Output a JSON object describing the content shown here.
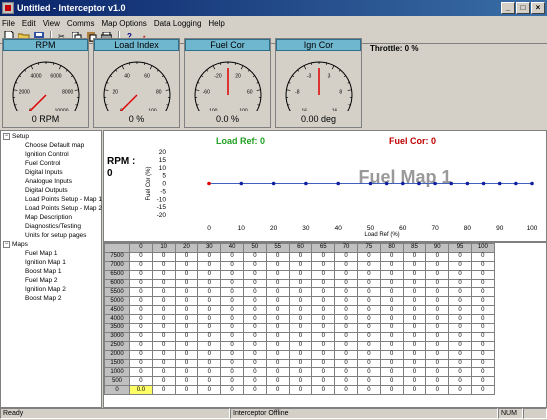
{
  "window": {
    "title": "Untitled - Interceptor v1.0"
  },
  "menu": [
    "File",
    "Edit",
    "View",
    "Comms",
    "Map Options",
    "Data Logging",
    "Help"
  ],
  "toolbar": [
    "new-icon",
    "open-icon",
    "save-icon",
    "cut-icon",
    "copy-icon",
    "paste-icon",
    "print-icon",
    "help-icon",
    "pin-icon"
  ],
  "gauges": [
    {
      "title": "RPM",
      "value_text": "0 RPM",
      "ticks": [
        "0",
        "2000",
        "4000",
        "6000",
        "8000",
        "10000"
      ],
      "min": 0,
      "max": 10000,
      "value": 0
    },
    {
      "title": "Load Index",
      "value_text": "0 %",
      "ticks": [
        "0",
        "20",
        "40",
        "60",
        "80",
        "100"
      ],
      "min": 0,
      "max": 100,
      "value": 0
    },
    {
      "title": "Fuel Cor",
      "value_text": "0.0 %",
      "ticks": [
        "-100",
        "-60",
        "-20",
        "20",
        "60",
        "100"
      ],
      "min": -100,
      "max": 100,
      "value": 0
    },
    {
      "title": "Ign Cor",
      "value_text": "0.00 deg",
      "ticks": [
        "-16",
        "-8",
        "-3",
        "3",
        "8",
        "16"
      ],
      "min": -16,
      "max": 16,
      "value": 0
    }
  ],
  "throttle": "Throttle: 0 %",
  "tree": {
    "setup_label": "Setup",
    "setup_items": [
      "Choose Default map",
      "Ignition Control",
      "Fuel Control",
      "Digital Inputs",
      "Analogue Inputs",
      "Digital Outputs",
      "Load Points Setup - Map 1",
      "Load Points Setup - Map 2",
      "Map Description",
      "Diagnostics/Testing",
      "Units for setup pages"
    ],
    "maps_label": "Maps",
    "maps_items": [
      "Fuel Map 1",
      "Ignition Map 1",
      "Boost Map 1",
      "Fuel Map 2",
      "Ignition Map 2",
      "Boost Map 2"
    ]
  },
  "panel": {
    "rpm_label": "RPM :",
    "rpm_value": "0",
    "load_ref": "Load Ref: 0",
    "fuel_cor": "Fuel Cor: 0",
    "map_title": "Fuel Map 1",
    "load_ref_color": "#20a020",
    "fuel_cor_color": "#c00000"
  },
  "chart_data": {
    "type": "line",
    "xlabel": "Load Ref (%)",
    "ylabel": "Fuel Cor (%)",
    "x_ticks": [
      0,
      10,
      20,
      30,
      40,
      50,
      60,
      70,
      80,
      90,
      100
    ],
    "y_ticks": [
      20,
      15,
      10,
      5,
      0,
      -5,
      -10,
      -15,
      -20
    ],
    "ylim": [
      -20,
      20
    ],
    "x": [
      0,
      10,
      20,
      30,
      40,
      50,
      55,
      60,
      65,
      70,
      75,
      80,
      85,
      90,
      95,
      100
    ],
    "values": [
      0,
      0,
      0,
      0,
      0,
      0,
      0,
      0,
      0,
      0,
      0,
      0,
      0,
      0,
      0,
      0
    ],
    "selected_index": 0
  },
  "grid": {
    "columns": [
      "0",
      "10",
      "20",
      "30",
      "40",
      "50",
      "55",
      "60",
      "65",
      "70",
      "75",
      "80",
      "85",
      "90",
      "95",
      "100"
    ],
    "rows": [
      "7500",
      "7000",
      "6500",
      "6000",
      "5500",
      "5000",
      "4500",
      "4000",
      "3500",
      "3000",
      "2500",
      "2000",
      "1500",
      "1000",
      "500",
      "0"
    ],
    "cell_value": "0",
    "selected_value": "0.0"
  },
  "status": {
    "left": "Ready",
    "mid": "Interceptor Offline",
    "right": "NUM"
  }
}
